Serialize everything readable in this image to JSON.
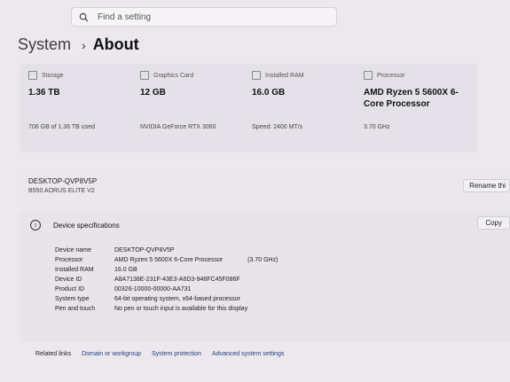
{
  "search": {
    "placeholder": "Find a setting"
  },
  "breadcrumb": {
    "parent": "System",
    "separator": "›",
    "current": "About"
  },
  "cards": [
    {
      "label": "Storage",
      "value": "1.36 TB",
      "sub": "706 GB of 1.36 TB used"
    },
    {
      "label": "Graphics Card",
      "value": "12 GB",
      "sub": "NVIDIA GeForce RTX 3060"
    },
    {
      "label": "Installed RAM",
      "value": "16.0 GB",
      "sub": "Speed: 2400 MT/s"
    },
    {
      "label": "Processor",
      "value": "AMD Ryzen 5 5600X 6-Core Processor",
      "sub": "3.70 GHz"
    }
  ],
  "device": {
    "name": "DESKTOP-QVP8V5P",
    "model": "B550 AORUS ELITE V2",
    "rename_label": "Rename thi"
  },
  "specs": {
    "title": "Device specifications",
    "copy_label": "Copy",
    "rows": [
      {
        "key": "Device name",
        "value": "DESKTOP-QVP8V5P",
        "extra": ""
      },
      {
        "key": "Processor",
        "value": "AMD Ryzen 5 5600X 6-Core Processor",
        "extra": "(3.70 GHz)"
      },
      {
        "key": "Installed RAM",
        "value": "16.0 GB",
        "extra": ""
      },
      {
        "key": "Device ID",
        "value": "A8A7138E-231F-43E3-A6D3-946FC45F086F",
        "extra": ""
      },
      {
        "key": "Product ID",
        "value": "00326-10000-00000-AA731",
        "extra": ""
      },
      {
        "key": "System type",
        "value": "64-bit operating system, x64-based processor",
        "extra": ""
      },
      {
        "key": "Pen and touch",
        "value": "No pen or touch input is available for this display",
        "extra": ""
      }
    ]
  },
  "related": {
    "label": "Related links",
    "links": [
      "Domain or workgroup",
      "System protection",
      "Advanced system settings"
    ]
  }
}
